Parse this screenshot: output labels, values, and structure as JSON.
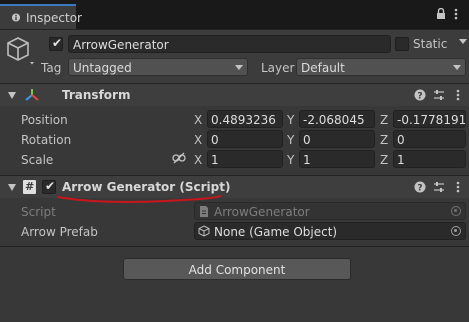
{
  "window": {
    "tab_label": "Inspector"
  },
  "header": {
    "object_name": "ArrowGenerator",
    "active_checked": true,
    "static_label": "Static",
    "tag_label": "Tag",
    "tag_value": "Untagged",
    "layer_label": "Layer",
    "layer_value": "Default"
  },
  "transform": {
    "title": "Transform",
    "position": {
      "label": "Position",
      "x": "0.4893236",
      "y": "-2.068045",
      "z": "-0.1778191"
    },
    "rotation": {
      "label": "Rotation",
      "x": "0",
      "y": "0",
      "z": "0"
    },
    "scale": {
      "label": "Scale",
      "x": "1",
      "y": "1",
      "z": "1"
    },
    "axis": {
      "x": "X",
      "y": "Y",
      "z": "Z"
    }
  },
  "script_component": {
    "title": "Arrow Generator (Script)",
    "enabled": true,
    "script_label": "Script",
    "script_value": "ArrowGenerator",
    "prefab_label": "Arrow Prefab",
    "prefab_value": "None (Game Object)"
  },
  "footer": {
    "add_component_label": "Add Component"
  },
  "colors": {
    "accent_tab": "#3a79bb",
    "annotation_underline": "#c8161c"
  }
}
